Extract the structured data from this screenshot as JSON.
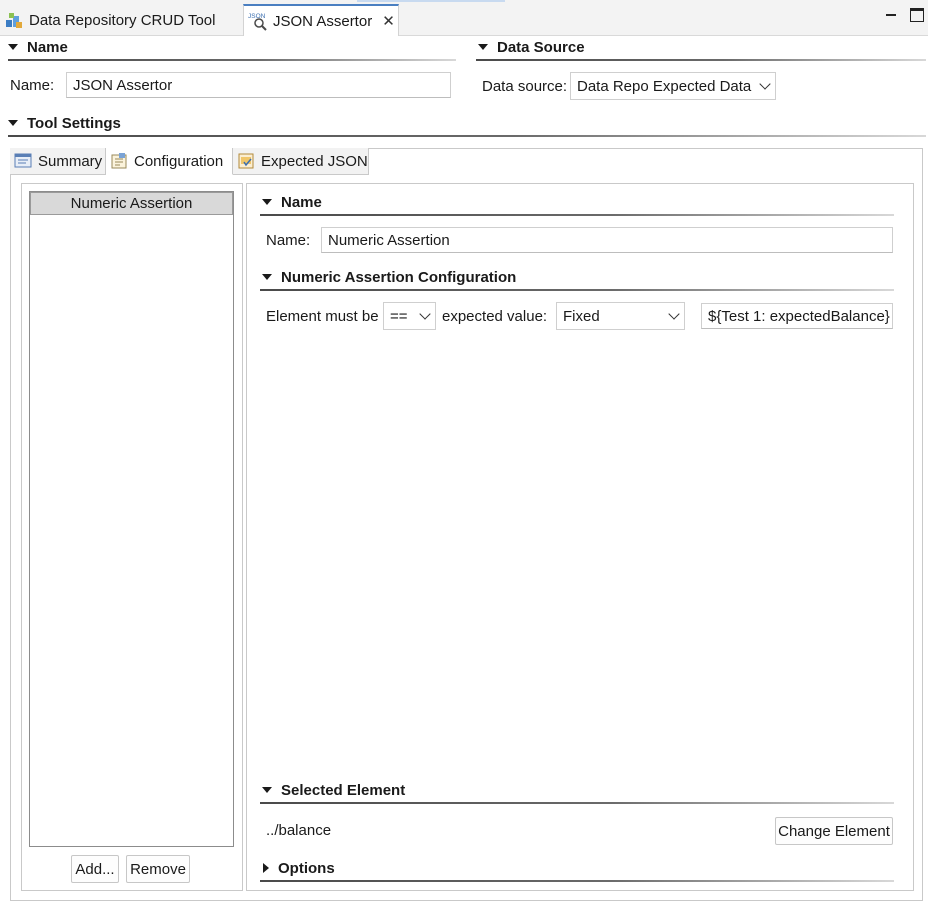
{
  "editor_tabs": {
    "tab1_label": "Data Repository CRUD Tool",
    "tab2_label": "JSON Assertor",
    "tab2_icon_text": "JSON",
    "close_glyph": "✕"
  },
  "name_section": {
    "header": "Name",
    "label": "Name:",
    "value": "JSON Assertor"
  },
  "data_source_section": {
    "header": "Data Source",
    "label": "Data source:",
    "selected": "Data Repo Expected Data"
  },
  "tool_settings": {
    "header": "Tool Settings",
    "tabs": [
      "Summary",
      "Configuration",
      "Expected JSON"
    ]
  },
  "assertion_list": {
    "items": [
      "Numeric Assertion"
    ],
    "add_label": "Add...",
    "remove_label": "Remove"
  },
  "details": {
    "name_header": "Name",
    "name_label": "Name:",
    "name_value": "Numeric Assertion",
    "config_header": "Numeric Assertion Configuration",
    "element_must_be_label": "Element must be",
    "operator_selected": "==",
    "expected_value_label": "expected value:",
    "expected_mode_selected": "Fixed",
    "expected_value": "${Test 1: expectedBalance}",
    "selected_element_header": "Selected Element",
    "selected_element_path": "../balance",
    "change_element_label": "Change Element",
    "options_header": "Options"
  },
  "colors": {
    "active_tab_accent": "#4a7fc1",
    "list_selection": "#d9d9d9"
  }
}
